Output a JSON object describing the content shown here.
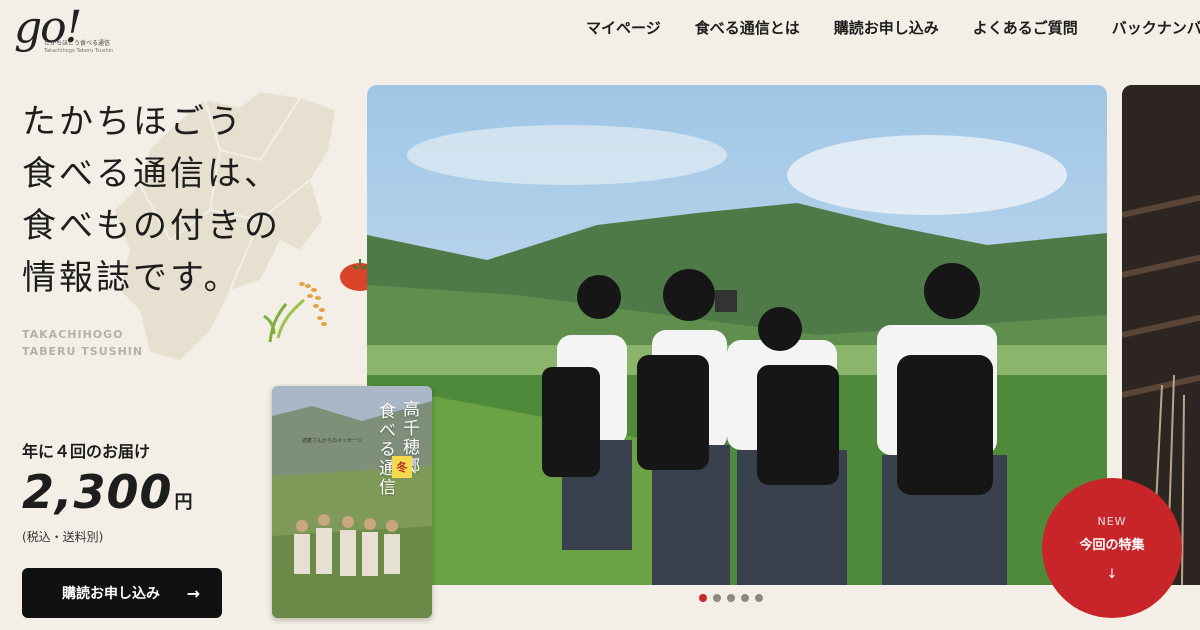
{
  "header": {
    "logo_mark": "go!",
    "logo_sub": "たかちほごう食べる通信",
    "logo_sub2": "Takachihogo Taberu Tsushin",
    "nav": [
      {
        "label": "マイページ"
      },
      {
        "label": "食べる通信とは"
      },
      {
        "label": "購読お申し込み"
      },
      {
        "label": "よくあるご質問"
      },
      {
        "label": "バックナンバー"
      }
    ]
  },
  "hero": {
    "headline": [
      "たかちほごう",
      "食べる通信は、",
      "食べもの付きの",
      "情報誌です。"
    ],
    "sub_en": [
      "TAKACHIHOGO",
      "TABERU TSUSHIN"
    ],
    "frequency": "年に４回のお届け",
    "price": "2,300",
    "price_unit": "円",
    "price_note": "(税込・送料別)",
    "cta_label": "購読お申し込み"
  },
  "magazine": {
    "title_a": "高千穂郷",
    "title_b": "食べる通信",
    "season": "冬",
    "note": "読者さんからのメッセージ"
  },
  "slider": {
    "dot_count": 5,
    "active_index": 0
  },
  "feature": {
    "badge": "NEW",
    "label": "今回の特集"
  },
  "colors": {
    "background": "#f3efe6",
    "accent_red": "#c8252b",
    "cta": "#111111"
  }
}
